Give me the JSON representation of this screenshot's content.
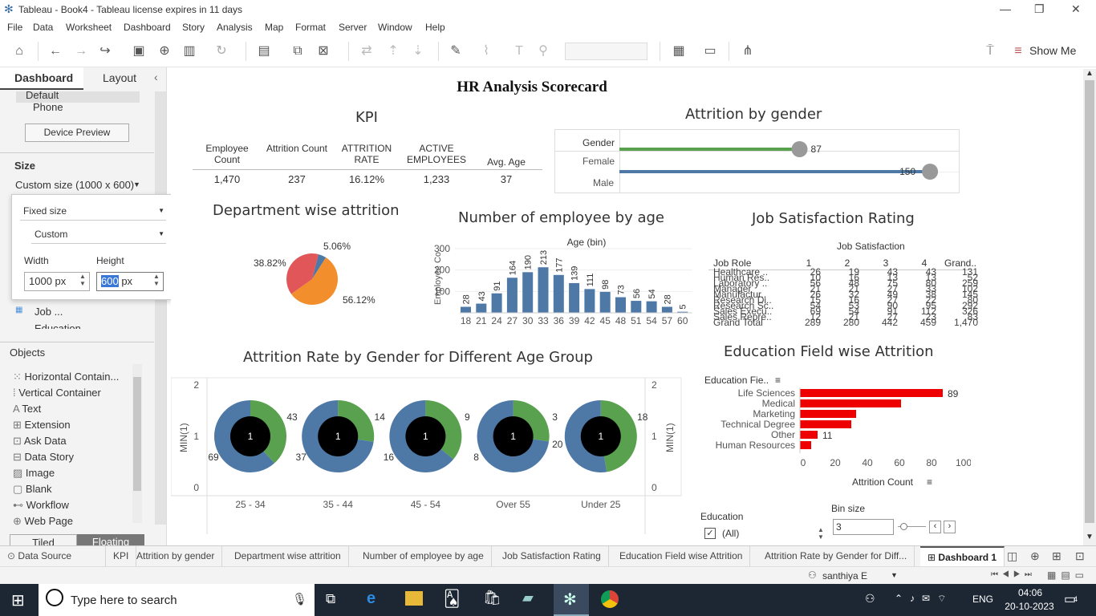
{
  "window": {
    "title": "Tableau - Book4 - Tableau license expires in 11 days"
  },
  "menu": [
    "File",
    "Data",
    "Worksheet",
    "Dashboard",
    "Story",
    "Analysis",
    "Map",
    "Format",
    "Server",
    "Window",
    "Help"
  ],
  "toolbar": {
    "show_me": "Show Me"
  },
  "sidebar": {
    "tab_dashboard": "Dashboard",
    "tab_layout": "Layout",
    "device_default": "Default",
    "device_phone": "Phone",
    "device_preview": "Device Preview",
    "size_label": "Size",
    "size_value": "Custom size (1000 x 600)",
    "fixed_size": "Fixed size",
    "custom": "Custom",
    "width_label": "Width",
    "height_label": "Height",
    "width_value": "1000 px",
    "height_value": "600",
    "height_unit": "px",
    "sheet_job": "Job ...",
    "sheet_edu": "Education",
    "objects_label": "Objects",
    "objects": [
      "Horizontal Contain...",
      "Vertical Container",
      "Text",
      "Extension",
      "Ask Data",
      "Data Story",
      "Image",
      "Blank",
      "Workflow",
      "Web Page"
    ],
    "tiled": "Tiled",
    "floating": "Floating"
  },
  "dashboard": {
    "title": "HR Analysis Scorecard",
    "kpi": {
      "title": "KPI",
      "headers": [
        "Employee Count",
        "Attrition Count",
        "ATTRITION RATE",
        "ACTIVE EMPLOYEES",
        "Avg. Age"
      ],
      "values": [
        "1,470",
        "237",
        "16.12%",
        "1,233",
        "37"
      ]
    },
    "gender": {
      "title": "Attrition by gender",
      "header": "Gender",
      "rows": [
        {
          "label": "Female",
          "value": 87,
          "color": "#59a14f"
        },
        {
          "label": "Male",
          "value": 150,
          "color": "#4e79a7"
        }
      ]
    },
    "dept": {
      "title": "Department wise attrition",
      "slices": [
        {
          "label": "5.06%",
          "value": 5.06,
          "color": "#4e79a7"
        },
        {
          "label": "56.12%",
          "value": 56.12,
          "color": "#f28e2b"
        },
        {
          "label": "38.82%",
          "value": 38.82,
          "color": "#e15759"
        }
      ]
    },
    "age": {
      "title": "Number of employee by age",
      "col_header": "Age (bin)",
      "ylabel": "Employee Co..",
      "yticks": [
        "300",
        "200",
        "100"
      ],
      "bins": [
        "18",
        "21",
        "24",
        "27",
        "30",
        "33",
        "36",
        "39",
        "42",
        "45",
        "48",
        "51",
        "54",
        "57",
        "60"
      ],
      "values": [
        28,
        43,
        91,
        164,
        190,
        213,
        177,
        139,
        111,
        98,
        73,
        56,
        54,
        28,
        5
      ]
    },
    "jobsat": {
      "title": "Job Satisfaction Rating",
      "col_header": "Job Satisfaction",
      "headers": [
        "Job Role",
        "1",
        "2",
        "3",
        "4",
        "Grand.."
      ],
      "rows": [
        [
          "Healthcare ..",
          "26",
          "19",
          "43",
          "43",
          "131"
        ],
        [
          "Human Res..",
          "10",
          "16",
          "13",
          "13",
          "52"
        ],
        [
          "Laboratory ..",
          "56",
          "48",
          "75",
          "80",
          "259"
        ],
        [
          "Manager",
          "21",
          "21",
          "27",
          "33",
          "102"
        ],
        [
          "Manufactur..",
          "26",
          "32",
          "49",
          "38",
          "145"
        ],
        [
          "Research Di..",
          "15",
          "16",
          "27",
          "22",
          "80"
        ],
        [
          "Research Sc..",
          "54",
          "53",
          "90",
          "95",
          "292"
        ],
        [
          "Sales Execu..",
          "69",
          "54",
          "91",
          "112",
          "326"
        ],
        [
          "Sales Repre..",
          "12",
          "21",
          "27",
          "23",
          "83"
        ],
        [
          "Grand Total",
          "289",
          "280",
          "442",
          "459",
          "1,470"
        ]
      ]
    },
    "agegroup": {
      "title": "Attrition Rate by Gender for Different Age Group",
      "ylabel": "MIN(1)",
      "yticks": [
        "2",
        "1",
        "0"
      ],
      "groups": [
        {
          "label": "25 - 34",
          "female": 43,
          "male": 69,
          "center": "1"
        },
        {
          "label": "35 - 44",
          "female": 14,
          "male": 37,
          "center": "1"
        },
        {
          "label": "45 - 54",
          "female": 9,
          "male": 16,
          "center": "1"
        },
        {
          "label": "Over 55",
          "female": 3,
          "male": 8,
          "center": "1"
        },
        {
          "label": "Under 25",
          "female": 18,
          "male": 20,
          "center": "1"
        }
      ],
      "female_color": "#59a14f",
      "male_color": "#4e79a7"
    },
    "edu": {
      "title": "Education Field wise Attrition",
      "header": "Education Fie..",
      "xlabel": "Attrition Count",
      "xticks": [
        "0",
        "20",
        "40",
        "60",
        "80",
        "100"
      ],
      "rows": [
        {
          "label": "Life Sciences",
          "value": 89,
          "show": "89"
        },
        {
          "label": "Medical",
          "value": 63,
          "show": ""
        },
        {
          "label": "Marketing",
          "value": 35,
          "show": ""
        },
        {
          "label": "Technical Degree",
          "value": 32,
          "show": ""
        },
        {
          "label": "Other",
          "value": 11,
          "show": "11"
        },
        {
          "label": "Human Resources",
          "value": 7,
          "show": ""
        }
      ],
      "color": "#ee0000"
    },
    "filter": {
      "title": "Education",
      "option": "(All)"
    },
    "binsize": {
      "title": "Bin size",
      "value": "3"
    }
  },
  "tabs": [
    "Data Source",
    "KPI",
    "Attrition by gender",
    "Department wise attrition",
    "Number of employee by age",
    "Job Satisfaction Rating",
    "Education Field wise Attrition",
    "Attrition Rate by Gender for Diff...",
    "Dashboard 1"
  ],
  "status": {
    "user": "santhiya E"
  },
  "taskbar": {
    "search_placeholder": "Type here to search",
    "lang": "ENG",
    "time": "04:06",
    "date": "20-10-2023",
    "notifications": "4"
  }
}
